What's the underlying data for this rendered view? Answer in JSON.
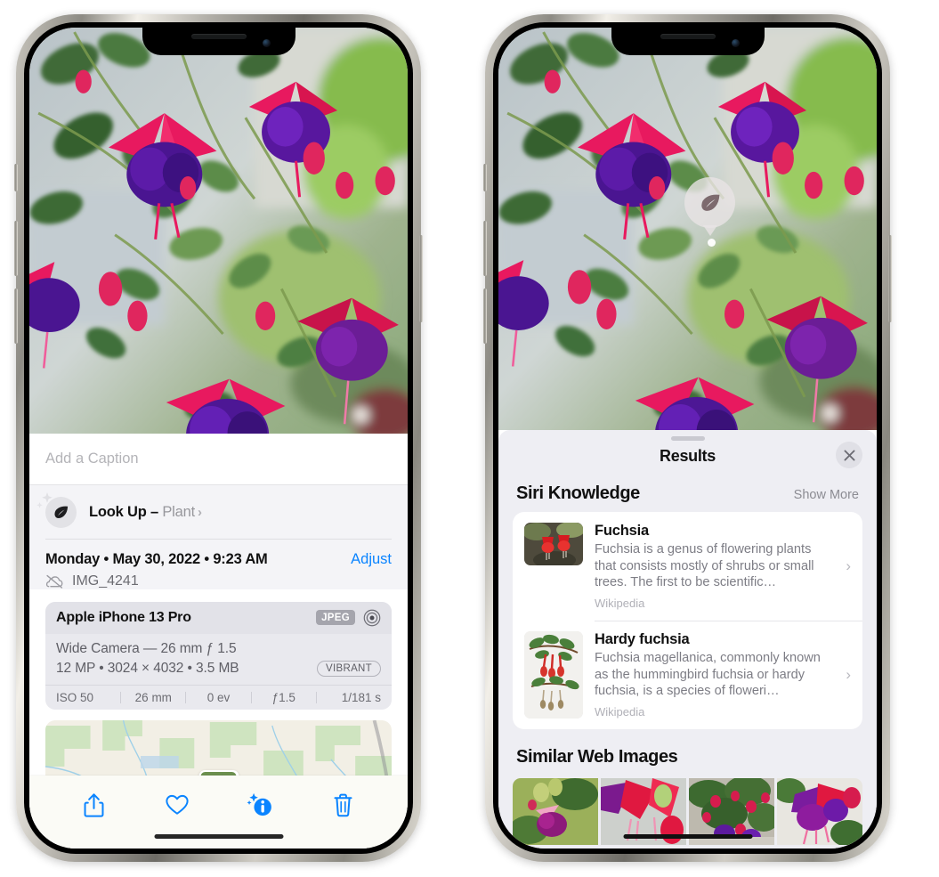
{
  "left_phone": {
    "caption_placeholder": "Add a Caption",
    "lookup": {
      "label": "Look Up",
      "separator": " – ",
      "subject": "Plant",
      "chevron": "›",
      "icon": "leaf-icon"
    },
    "metadata": {
      "date": "Monday • May 30, 2022 • 9:23 AM",
      "adjust_label": "Adjust",
      "filename": "IMG_4241",
      "filename_icon": "no-cloud-icon"
    },
    "exif": {
      "device": "Apple iPhone 13 Pro",
      "format_badge": "JPEG",
      "hdr_icon": "hdr-circle-icon",
      "lens_line": "Wide Camera — 26 mm ƒ 1.5",
      "size_line": "12 MP  •  3024 × 4032  •  3.5 MB",
      "style_badge": "VIBRANT",
      "stats": [
        "ISO 50",
        "26 mm",
        "0 ev",
        "ƒ1.5",
        "1/181 s"
      ]
    },
    "toolbar": [
      {
        "name": "share-icon",
        "label": "Share"
      },
      {
        "name": "heart-icon",
        "label": "Favorite"
      },
      {
        "name": "info-sparkle-icon",
        "label": "Info",
        "active": true
      },
      {
        "name": "trash-icon",
        "label": "Delete"
      }
    ]
  },
  "right_phone": {
    "visual_lookup_badge": {
      "icon": "leaf-icon"
    },
    "sheet": {
      "title": "Results",
      "close_icon": "close-icon",
      "siri_knowledge": {
        "heading": "Siri Knowledge",
        "show_more": "Show More",
        "items": [
          {
            "title": "Fuchsia",
            "description": "Fuchsia is a genus of flowering plants that consists mostly of shrubs or small trees. The first to be scientific…",
            "source": "Wikipedia",
            "chevron": "›"
          },
          {
            "title": "Hardy fuchsia",
            "description": "Fuchsia magellanica, commonly known as the hummingbird fuchsia or hardy fuchsia, is a species of floweri…",
            "source": "Wikipedia",
            "chevron": "›"
          }
        ]
      },
      "similar_web_images": {
        "heading": "Similar Web Images",
        "count": 4
      }
    }
  },
  "colors": {
    "accent_blue": "#0a84ff",
    "sheet_bg": "#eeeef3",
    "card_bg": "#ffffff",
    "secondary_text": "#7d7d85",
    "exif_bg": "#e9e9ee"
  }
}
